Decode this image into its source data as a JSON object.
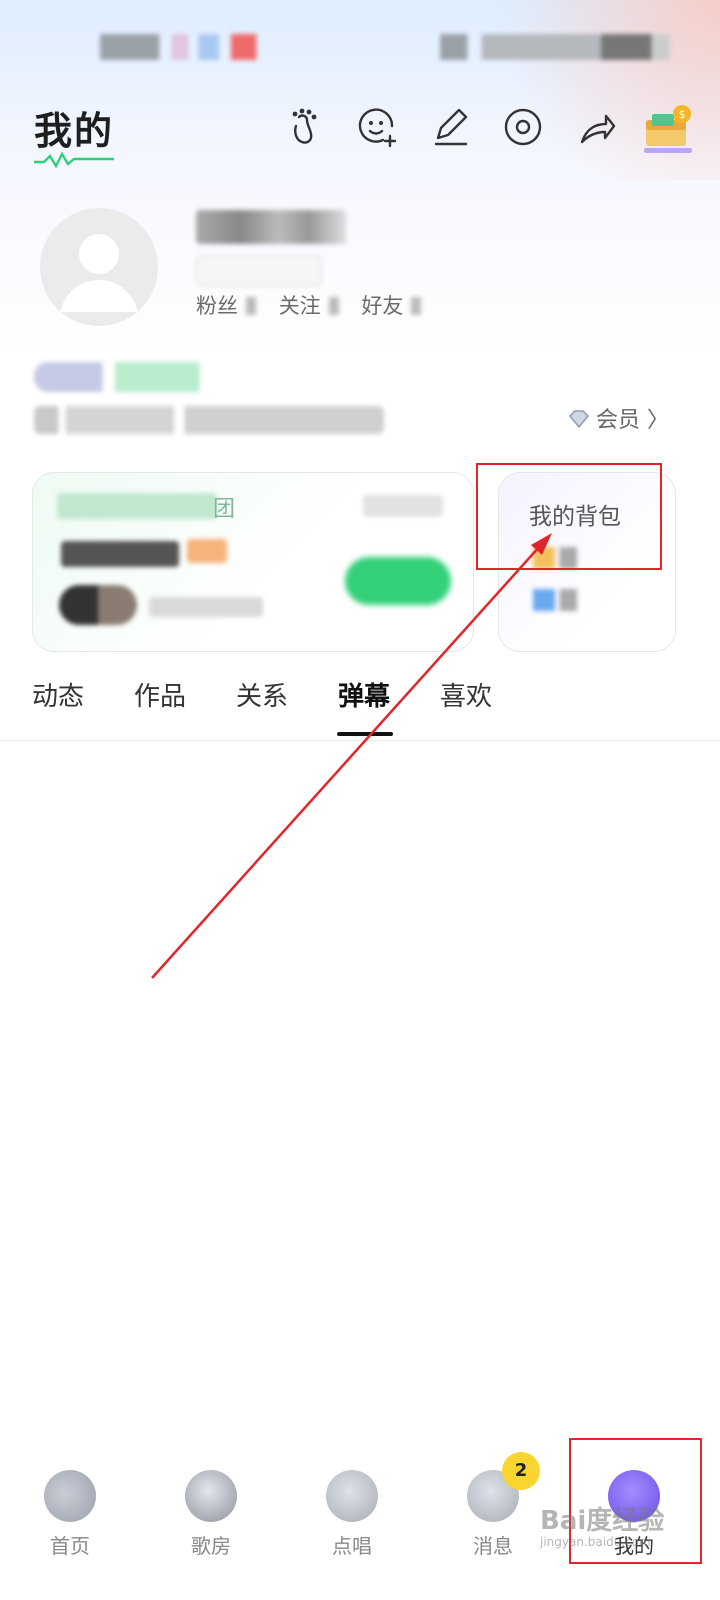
{
  "header": {
    "title": "我的",
    "icons": [
      "footprint-icon",
      "add-friend-icon",
      "edit-icon",
      "settings-icon",
      "share-icon",
      "treasure-box-icon"
    ]
  },
  "profile": {
    "stats": [
      "粉丝",
      "关注",
      "好友"
    ]
  },
  "vip": {
    "label": "会员 〉"
  },
  "cards": {
    "left_group_suffix": "团",
    "bag": {
      "title": "我的背包"
    }
  },
  "tabs": [
    {
      "label": "动态",
      "active": false
    },
    {
      "label": "作品",
      "active": false
    },
    {
      "label": "关系",
      "active": false
    },
    {
      "label": "弹幕",
      "active": true
    },
    {
      "label": "喜欢",
      "active": false
    }
  ],
  "bottom_nav": [
    {
      "label": "首页",
      "icon": "home-icon",
      "active": false
    },
    {
      "label": "歌房",
      "icon": "song-room-icon",
      "active": false
    },
    {
      "label": "点唱",
      "icon": "sing-request-icon",
      "active": false
    },
    {
      "label": "消息",
      "icon": "message-icon",
      "active": false,
      "badge": "2"
    },
    {
      "label": "我的",
      "icon": "me-icon",
      "active": true
    }
  ],
  "watermark": {
    "text": "Bai度经验",
    "sub": "jingyan.baidu.com"
  },
  "colors": {
    "annotation": "#e0262a",
    "accent_green": "#33d17a",
    "badge": "#f9d62f",
    "active_nav": "#7b5cf2"
  }
}
